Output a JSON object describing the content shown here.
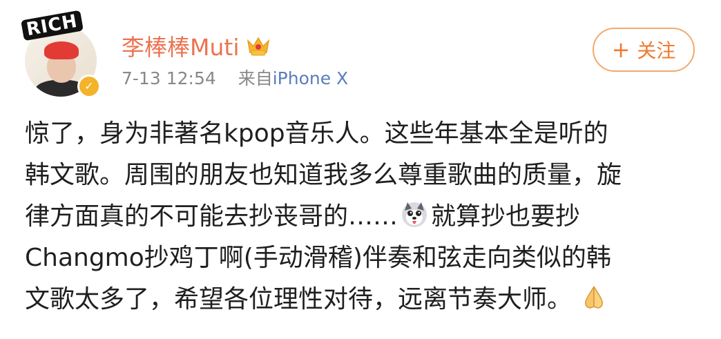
{
  "post": {
    "author": {
      "name": "李棒棒Muti",
      "avatar_sticker": "RICH"
    },
    "meta": {
      "date": "7-13",
      "time": "12:54",
      "from_label": "来自",
      "device": "iPhone X"
    },
    "follow_button": {
      "icon": "+",
      "label": "关注"
    },
    "content_lines": [
      "惊了，身为非著名kpop音乐人。这些年基本全是听的",
      "韩文歌。周围的朋友也知道我多么尊重歌曲的质量，旋",
      "律方面真的不可能去抄丧哥的……",
      "就算抄也要抄",
      "Changmo抄鸡丁啊(手动滑稽)伴奏和弦走向类似的韩",
      "文歌太多了，希望各位理性对待，远离节奏大师。"
    ],
    "icons": {
      "verified": "verified-badge-icon",
      "vip": "vip-crown-icon",
      "husky": "husky-emoji-icon",
      "hands": "pressed-hands-emoji-icon"
    },
    "colors": {
      "username": "#eb7350",
      "device": "#5a7dbb",
      "follow_border": "#f1a96d",
      "follow_text": "#ef7b2f",
      "verified_badge": "#f3b32a"
    }
  }
}
